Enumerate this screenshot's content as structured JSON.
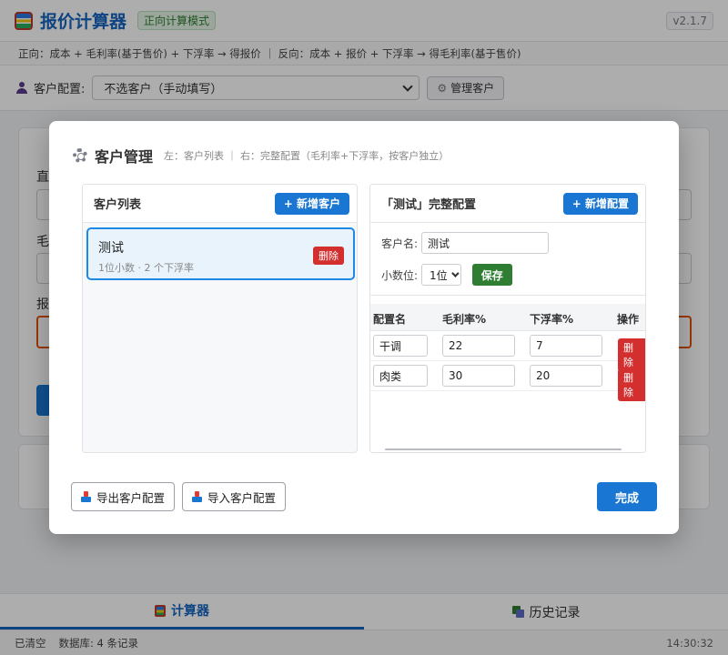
{
  "app": {
    "title": "报价计算器",
    "mode_badge": "正向计算模式",
    "version": "v2.1.7"
  },
  "hint": "正向：成本 + 毛利率(基于售价) + 下浮率 → 得报价 ｜ 反向：成本 + 报价 + 下浮率 → 得毛利率(基于售价)",
  "client_bar": {
    "label": "客户配置:",
    "selected": "不选客户（手动填写）",
    "manage_button": "管理客户"
  },
  "background": {
    "label_1": "直",
    "label_2": "毛",
    "label_3": "报"
  },
  "modal": {
    "title": "客户管理",
    "subtitle": "左：客户列表 ｜ 右：完整配置（毛利率+下浮率，按客户独立）",
    "left_panel": {
      "title": "客户列表",
      "add_button": "+ 新增客户",
      "clients": [
        {
          "name": "测试",
          "meta": "1位小数 · 2 个下浮率",
          "delete_label": "删除"
        }
      ]
    },
    "right_panel": {
      "title": "「测试」完整配置",
      "add_button": "+ 新增配置",
      "client_name_label": "客户名:",
      "client_name_value": "测试",
      "decimal_label": "小数位:",
      "decimal_value": "1位",
      "save_button": "保存",
      "columns": [
        "配置名",
        "毛利率%",
        "下浮率%",
        "操作"
      ],
      "rows": [
        {
          "name": "干调",
          "margin": "22",
          "discount": "7",
          "action": "删除"
        },
        {
          "name": "肉类",
          "margin": "30",
          "discount": "20",
          "action": "删除"
        }
      ]
    },
    "export_button": "导出客户配置",
    "import_button": "导入客户配置",
    "done_button": "完成"
  },
  "bottom_nav": {
    "tabs": [
      {
        "label": "计算器",
        "active": true
      },
      {
        "label": "历史记录",
        "active": false
      }
    ]
  },
  "status": {
    "left": "已清空",
    "db": "数据库: 4 条记录",
    "time": "14:30:32"
  },
  "colors": {
    "primary": "#1976d2",
    "danger": "#d32f2f",
    "success": "#2e7d32"
  }
}
